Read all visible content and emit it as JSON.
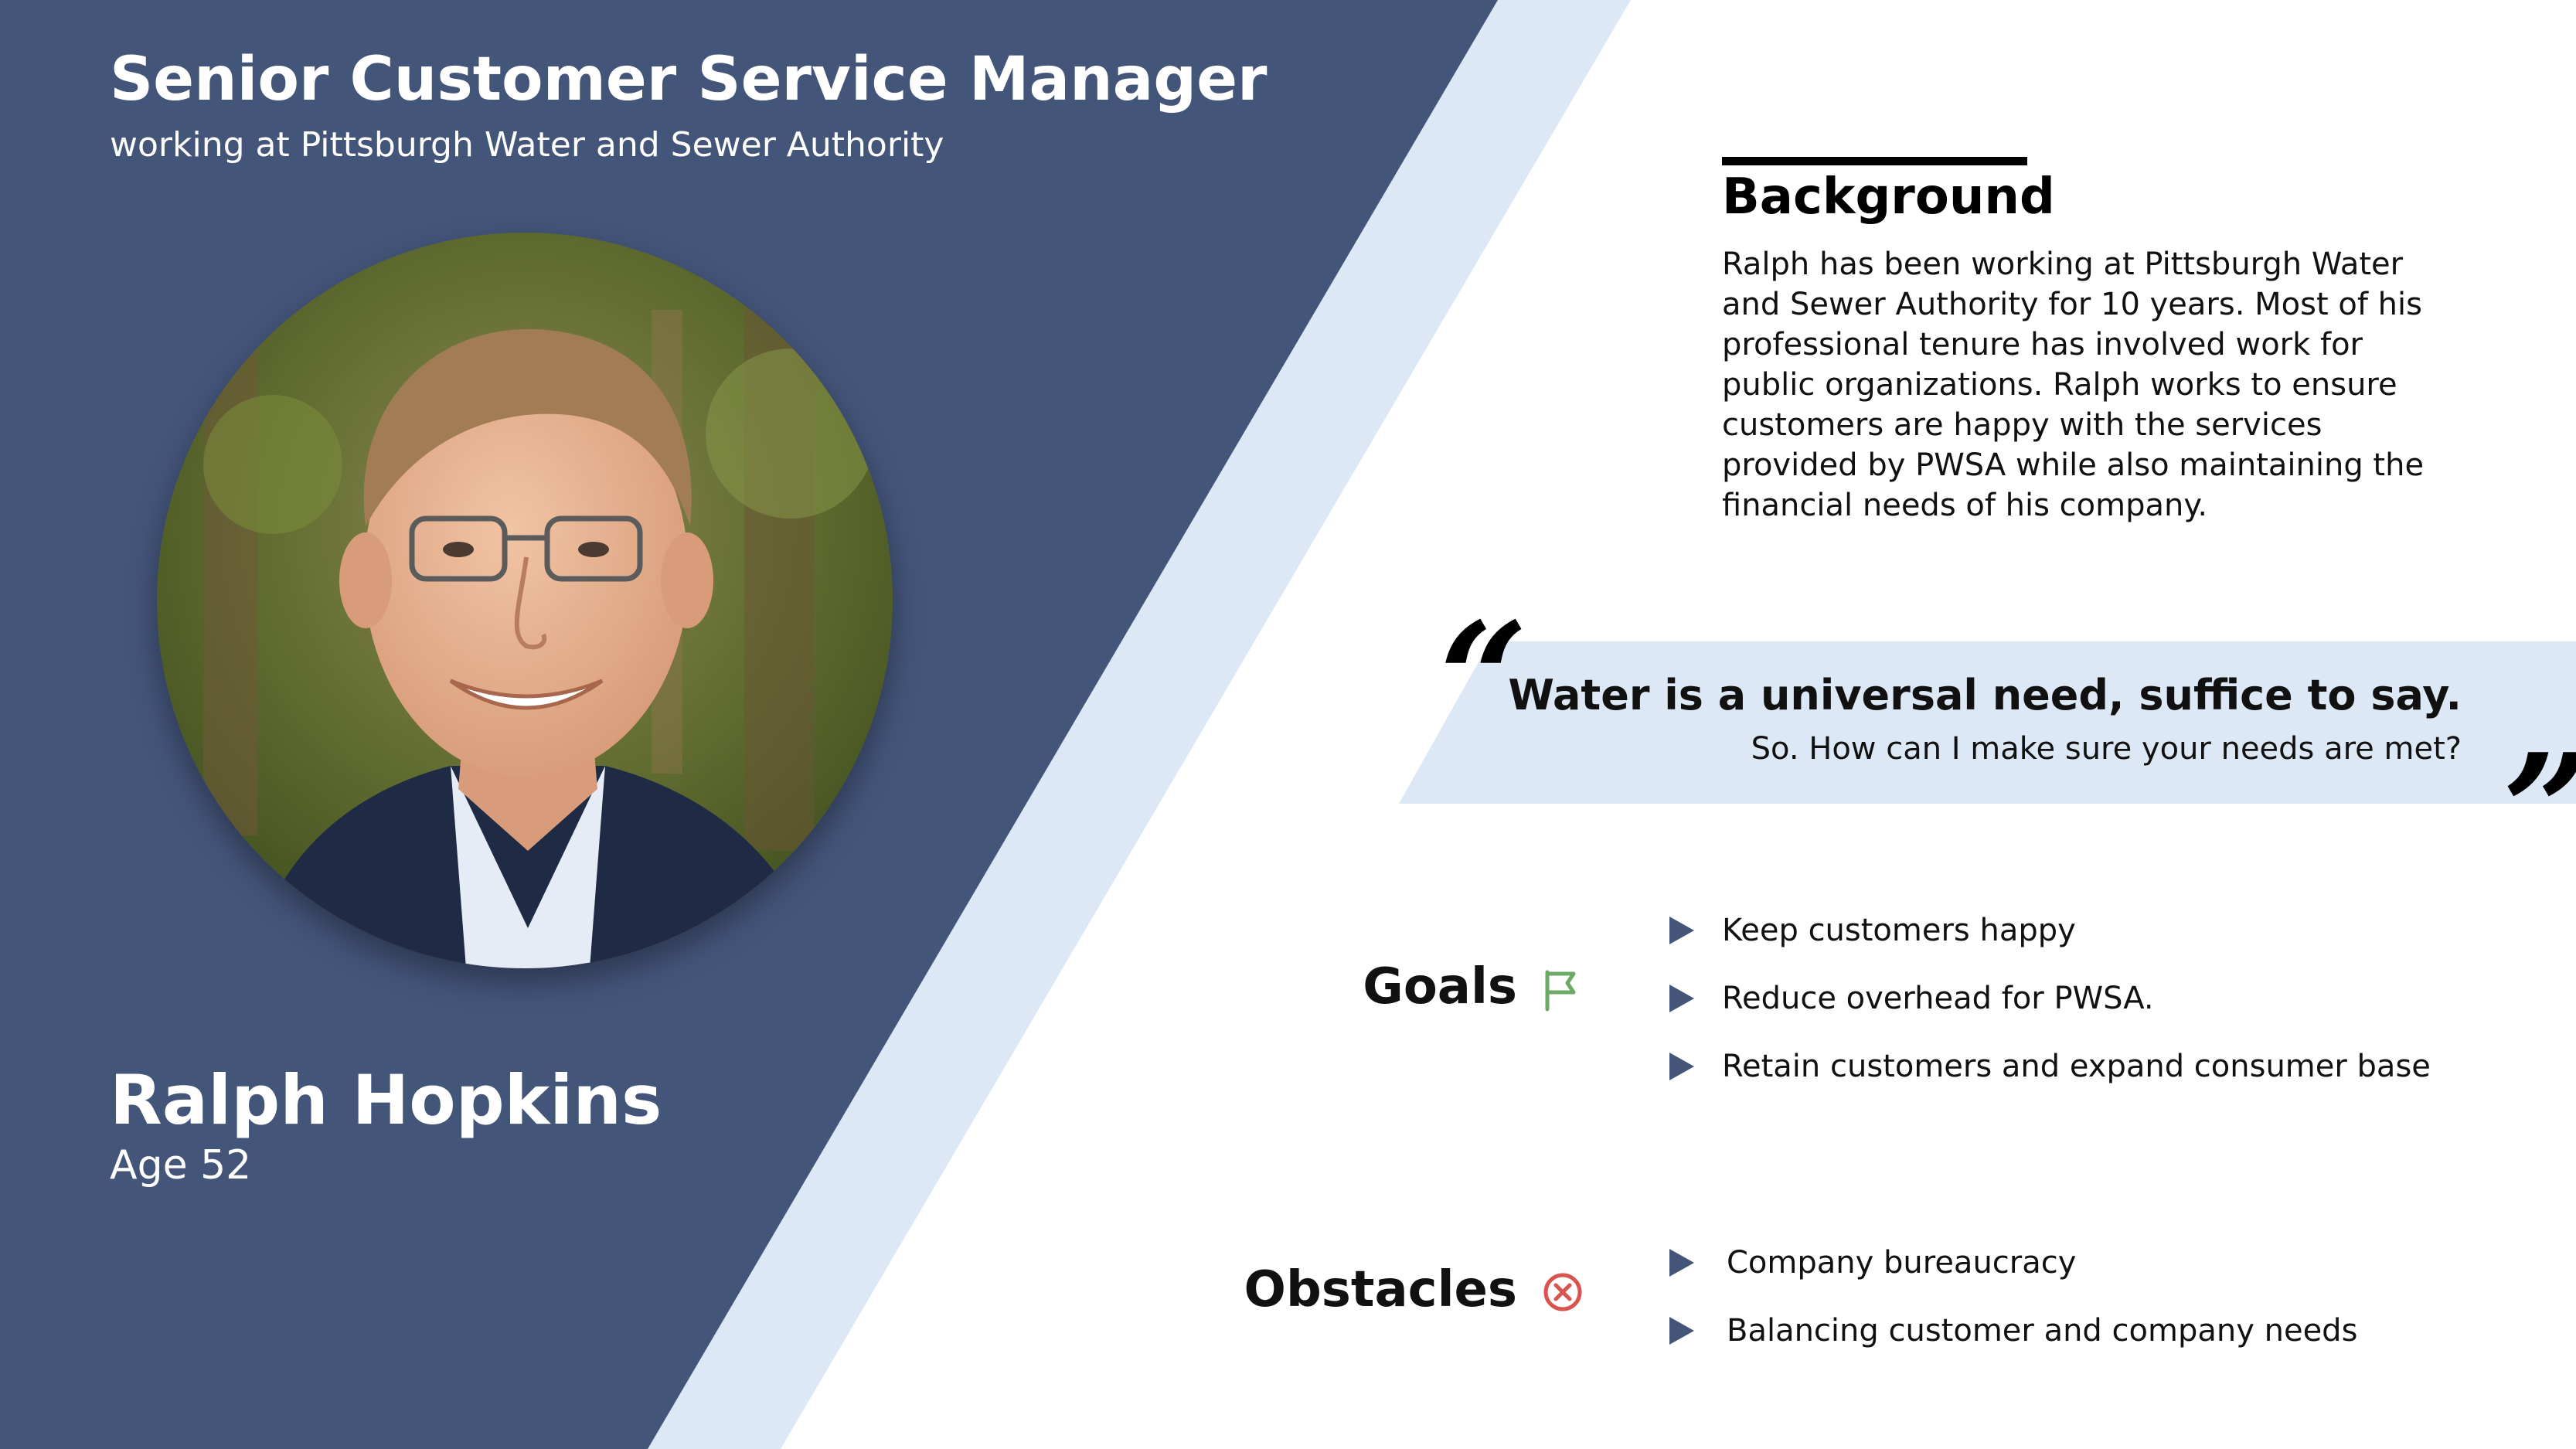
{
  "header": {
    "job_title": "Senior Customer Service Manager",
    "job_subtitle": "working at Pittsburgh Water and Sewer Authority"
  },
  "person": {
    "name": "Ralph Hopkins",
    "age": "Age 52"
  },
  "background": {
    "heading": "Background",
    "body": "Ralph has been working at Pittsburgh Water and Sewer Authority for 10 years. Most of his professional tenure has involved work for public organizations. Ralph works to ensure customers are happy with the services provided by PWSA while also maintaining the financial needs of his company."
  },
  "quote": {
    "open_mark": "“",
    "close_mark": "”",
    "main": "Water is a universal need, suffice to say.",
    "sub": "So. How can I make sure your needs are met?"
  },
  "goals": {
    "title": "Goals",
    "icon": "flag-icon",
    "items": [
      "Keep customers happy",
      "Reduce overhead for PWSA.",
      "Retain customers and expand consumer base"
    ]
  },
  "obstacles": {
    "title": "Obstacles",
    "icon": "x-circle-icon",
    "items": [
      "Company bureaucracy",
      "Balancing customer and company needs"
    ]
  },
  "colors": {
    "navy_panel": "#44557a",
    "light_band": "#dce8f5",
    "flag_green": "#6aaa64",
    "obstacle_red": "#d9534f"
  }
}
